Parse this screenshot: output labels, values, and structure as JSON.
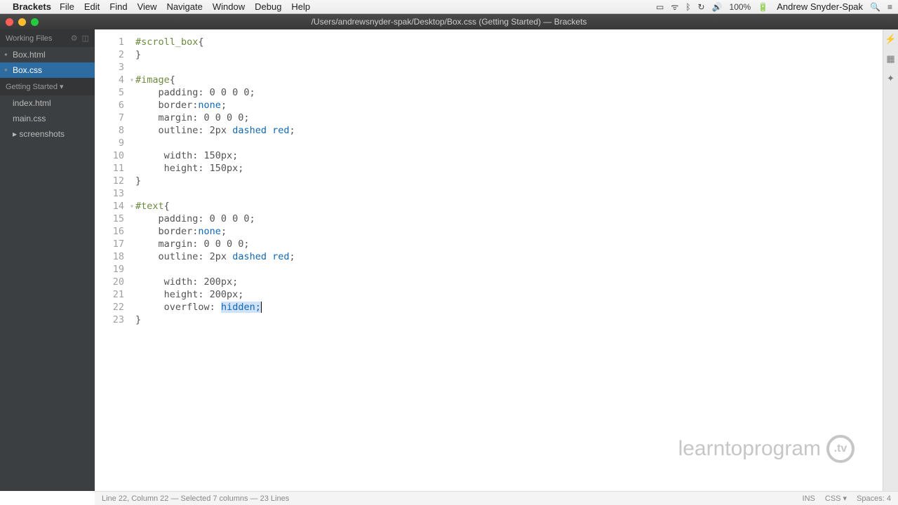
{
  "menubar": {
    "app_name": "Brackets",
    "items": [
      "File",
      "Edit",
      "Find",
      "View",
      "Navigate",
      "Window",
      "Debug",
      "Help"
    ],
    "battery": "100%",
    "username": "Andrew Snyder-Spak"
  },
  "titlebar": {
    "title": "/Users/andrewsnyder-spak/Desktop/Box.css (Getting Started) — Brackets"
  },
  "sidebar": {
    "working_files_label": "Working Files",
    "working_files": [
      {
        "name": "Box.html",
        "active": false
      },
      {
        "name": "Box.css",
        "active": true
      }
    ],
    "project_label": "Getting Started ▾",
    "project_files": [
      {
        "name": "index.html"
      },
      {
        "name": "main.css"
      },
      {
        "name": "screenshots",
        "folder": true
      }
    ]
  },
  "code": {
    "lines": [
      {
        "n": 1,
        "tokens": [
          {
            "t": "#scroll_box",
            "c": "tok-selector"
          },
          {
            "t": "{",
            "c": ""
          }
        ]
      },
      {
        "n": 2,
        "tokens": [
          {
            "t": "}",
            "c": ""
          }
        ]
      },
      {
        "n": 3,
        "tokens": []
      },
      {
        "n": 4,
        "fold": true,
        "tokens": [
          {
            "t": "#image",
            "c": "tok-selector"
          },
          {
            "t": "{",
            "c": ""
          }
        ]
      },
      {
        "n": 5,
        "tokens": [
          {
            "t": "    padding",
            "c": "tok-prop"
          },
          {
            "t": ": 0 0 0 0;",
            "c": "tok-value"
          }
        ]
      },
      {
        "n": 6,
        "tokens": [
          {
            "t": "    border",
            "c": "tok-prop"
          },
          {
            "t": ":",
            "c": ""
          },
          {
            "t": "none",
            "c": "tok-none"
          },
          {
            "t": ";",
            "c": ""
          }
        ]
      },
      {
        "n": 7,
        "tokens": [
          {
            "t": "    margin",
            "c": "tok-prop"
          },
          {
            "t": ": 0 0 0 0;",
            "c": "tok-value"
          }
        ]
      },
      {
        "n": 8,
        "tokens": [
          {
            "t": "    outline",
            "c": "tok-prop"
          },
          {
            "t": ": 2px ",
            "c": "tok-value"
          },
          {
            "t": "dashed",
            "c": "tok-dashed"
          },
          {
            "t": " ",
            "c": ""
          },
          {
            "t": "red",
            "c": "tok-red"
          },
          {
            "t": ";",
            "c": ""
          }
        ]
      },
      {
        "n": 9,
        "tokens": []
      },
      {
        "n": 10,
        "tokens": [
          {
            "t": "     width",
            "c": "tok-prop"
          },
          {
            "t": ": 150px;",
            "c": "tok-value"
          }
        ]
      },
      {
        "n": 11,
        "tokens": [
          {
            "t": "     height",
            "c": "tok-prop"
          },
          {
            "t": ": 150px;",
            "c": "tok-value"
          }
        ]
      },
      {
        "n": 12,
        "tokens": [
          {
            "t": "}",
            "c": ""
          }
        ]
      },
      {
        "n": 13,
        "tokens": []
      },
      {
        "n": 14,
        "fold": true,
        "tokens": [
          {
            "t": "#text",
            "c": "tok-selector"
          },
          {
            "t": "{",
            "c": ""
          }
        ]
      },
      {
        "n": 15,
        "tokens": [
          {
            "t": "    padding",
            "c": "tok-prop"
          },
          {
            "t": ": 0 0 0 0;",
            "c": "tok-value"
          }
        ]
      },
      {
        "n": 16,
        "tokens": [
          {
            "t": "    border",
            "c": "tok-prop"
          },
          {
            "t": ":",
            "c": ""
          },
          {
            "t": "none",
            "c": "tok-none"
          },
          {
            "t": ";",
            "c": ""
          }
        ]
      },
      {
        "n": 17,
        "tokens": [
          {
            "t": "    margin",
            "c": "tok-prop"
          },
          {
            "t": ": 0 0 0 0;",
            "c": "tok-value"
          }
        ]
      },
      {
        "n": 18,
        "tokens": [
          {
            "t": "    outline",
            "c": "tok-prop"
          },
          {
            "t": ": 2px ",
            "c": "tok-value"
          },
          {
            "t": "dashed",
            "c": "tok-dashed"
          },
          {
            "t": " ",
            "c": ""
          },
          {
            "t": "red",
            "c": "tok-red"
          },
          {
            "t": ";",
            "c": ""
          }
        ]
      },
      {
        "n": 19,
        "tokens": []
      },
      {
        "n": 20,
        "tokens": [
          {
            "t": "     width",
            "c": "tok-prop"
          },
          {
            "t": ": 200px;",
            "c": "tok-value"
          }
        ]
      },
      {
        "n": 21,
        "tokens": [
          {
            "t": "     height",
            "c": "tok-prop"
          },
          {
            "t": ": 200px;",
            "c": "tok-value"
          }
        ]
      },
      {
        "n": 22,
        "tokens": [
          {
            "t": "     overflow",
            "c": "tok-prop"
          },
          {
            "t": ": ",
            "c": ""
          },
          {
            "t": "hidden;",
            "c": "tok-hidden",
            "sel": true
          }
        ],
        "cursor_after": true
      },
      {
        "n": 23,
        "tokens": [
          {
            "t": "}",
            "c": ""
          }
        ]
      }
    ]
  },
  "statusbar": {
    "position": "Line 22, Column 22 — Selected 7 columns — 23 Lines",
    "ins": "INS",
    "lang": "CSS ▾",
    "spaces": "Spaces: 4"
  },
  "watermark": {
    "text": "learntoprogram",
    "badge": ".tv"
  }
}
